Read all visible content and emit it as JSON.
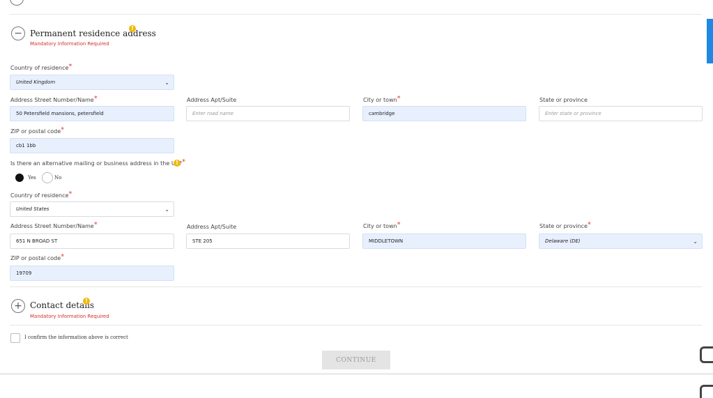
{
  "sections": {
    "permanent": {
      "toggle": "−",
      "title": "Permanent residence address",
      "info": "!",
      "mandatory": "Mandatory Information Required"
    },
    "contact": {
      "toggle": "+",
      "title": "Contact details",
      "info": "!",
      "mandatory": "Mandatory Information Required"
    }
  },
  "required_mark": "*",
  "primary": {
    "country_label": "Country of residence",
    "country_value": "United Kingdom",
    "street_label": "Address Street Number/Name",
    "street_value": "50 Petersfield mansions, petersfield",
    "apt_label": "Address Apt/Suite",
    "apt_placeholder": "Enter road name",
    "city_label": "City or town",
    "city_value": "cambridge",
    "state_label": "State or province",
    "state_placeholder": "Enter state or province",
    "zip_label": "ZIP or postal code",
    "zip_value": "cb1 1bb"
  },
  "alt_question": {
    "label": "Is there an alternative mailing or business address in the US?",
    "info": "!",
    "yes_label": "Yes",
    "no_label": "No",
    "selected": "Yes"
  },
  "secondary": {
    "country_label": "Country of residence",
    "country_value": "United States",
    "street_label": "Address Street Number/Name",
    "street_value": "651 N BROAD ST",
    "apt_label": "Address Apt/Suite",
    "apt_value": "STE 205",
    "city_label": "City or town",
    "city_value": "MIDDLETOWN",
    "state_label": "State or province",
    "state_value": "Delaware (DE)",
    "zip_label": "ZIP or postal code",
    "zip_value": "19709"
  },
  "confirm": {
    "label": "I confirm the information above is correct"
  },
  "continue_button": "CONTINUE",
  "colors": {
    "filled_bg": "#e8f0fe",
    "required": "#e53935",
    "info": "#f0b90b",
    "help_tab": "#1e88e5"
  }
}
